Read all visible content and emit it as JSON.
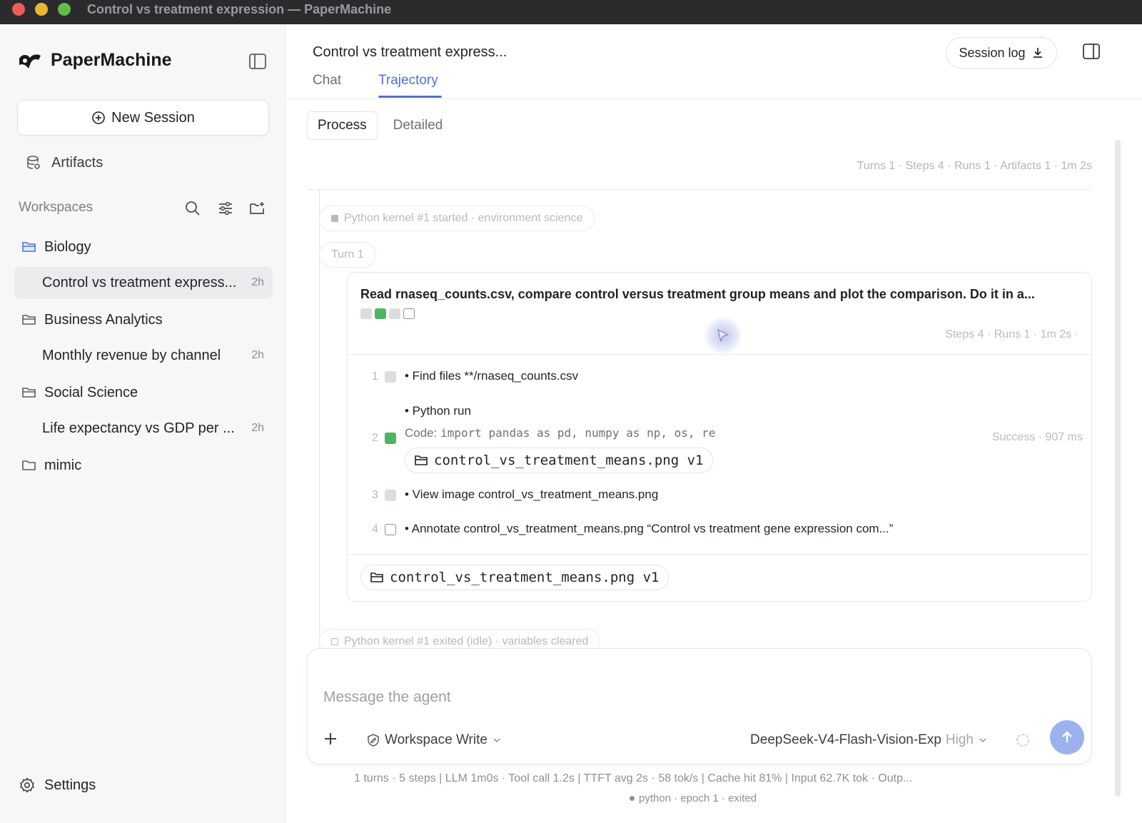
{
  "window": {
    "title": "Control vs treatment expression — PaperMachine"
  },
  "sidebar": {
    "app_name": "PaperMachine",
    "new_session_label": "New Session",
    "artifacts_label": "Artifacts",
    "workspaces_label": "Workspaces",
    "workspaces": [
      {
        "name": "Biology",
        "sessions": [
          {
            "title": "Control vs treatment express...",
            "age": "2h",
            "active": true
          }
        ]
      },
      {
        "name": "Business Analytics",
        "sessions": [
          {
            "title": "Monthly revenue by channel",
            "age": "2h"
          }
        ]
      },
      {
        "name": "Social Science",
        "sessions": [
          {
            "title": "Life expectancy vs GDP per ...",
            "age": "2h"
          }
        ]
      },
      {
        "name": "mimic",
        "sessions": []
      }
    ],
    "settings_label": "Settings"
  },
  "main": {
    "session_title": "Control vs treatment express...",
    "session_log_label": "Session log",
    "tabs": [
      {
        "label": "Chat"
      },
      {
        "label": "Trajectory",
        "active": true
      }
    ],
    "view_modes": [
      {
        "label": "Process",
        "active": true
      },
      {
        "label": "Detailed"
      }
    ],
    "summary_stats": "Turns 1 · Steps 4 · Runs 1 · Artifacts 1 · 1m 2s",
    "kernel_started": "Python kernel #1 started · environment science",
    "turn_label": "Turn 1",
    "turn": {
      "prompt": "Read rnaseq_counts.csv, compare control versus treatment group means and plot the comparison. Do it in a...",
      "stats": "Steps 4 · Runs 1 · 1m 2s ·",
      "steps": [
        {
          "num": "1",
          "text": "• Find files **/rnaseq_counts.csv"
        },
        {
          "num": "2",
          "text": "• Python run",
          "code_label": "Code:",
          "code": "import pandas as pd, numpy as np, os, re",
          "meta": "Success · 907 ms",
          "artifact": "control_vs_treatment_means.png v1"
        },
        {
          "num": "3",
          "text": "• View image control_vs_treatment_means.png"
        },
        {
          "num": "4",
          "text": "• Annotate control_vs_treatment_means.png “Control vs treatment gene expression com...”"
        }
      ],
      "output_artifact": "control_vs_treatment_means.png v1"
    },
    "kernel_exited": "Python kernel #1 exited (idle) · variables cleared",
    "composer": {
      "placeholder": "Message the agent",
      "permission": "Workspace Write",
      "model": "DeepSeek-V4-Flash-Vision-Exp",
      "model_level": "High"
    },
    "footer_stats": "1 turns · 5 steps   |   LLM 1m0s · Tool call 1.2s   |   TTFT avg 2s · 58 tok/s   |   Cache hit 81%   |   Input 62.7K tok · Outp...",
    "kernel_status": "python · epoch 1 · exited"
  },
  "colors": {
    "accent": "#4f6fd8",
    "success": "#4cb661",
    "send_button": "#9bb2ee"
  }
}
